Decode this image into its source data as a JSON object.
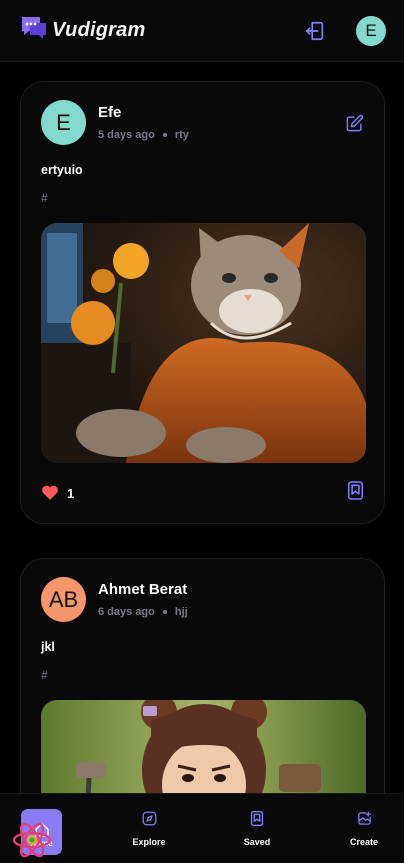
{
  "app": {
    "title": "Vudigram"
  },
  "header": {
    "user_initial": "E"
  },
  "posts": [
    {
      "author": "Efe",
      "initials": "E",
      "avatar_color": "#84d9cf",
      "time": "5 days ago",
      "location": "rty",
      "caption": "ertyuio",
      "tags": "#",
      "likes": "1",
      "liked": true,
      "image": "cat-in-orange-hoodie-photo"
    },
    {
      "author": "Ahmet Berat",
      "initials": "AB",
      "avatar_color": "#f6966a",
      "time": "6 days ago",
      "location": "hjj",
      "caption": "jkl",
      "tags": "#",
      "image": "angry-toddler-photo"
    }
  ],
  "bottom_nav": {
    "items": [
      {
        "label": "Home",
        "icon": "home-icon"
      },
      {
        "label": "Explore",
        "icon": "explore-icon"
      },
      {
        "label": "Saved",
        "icon": "bookmark-icon"
      },
      {
        "label": "Create",
        "icon": "create-post-icon"
      }
    ]
  },
  "colors": {
    "accent": "#877eff",
    "background": "#000000",
    "card": "#09090a",
    "like": "#ff5a5a",
    "muted": "#7a7b8c"
  }
}
